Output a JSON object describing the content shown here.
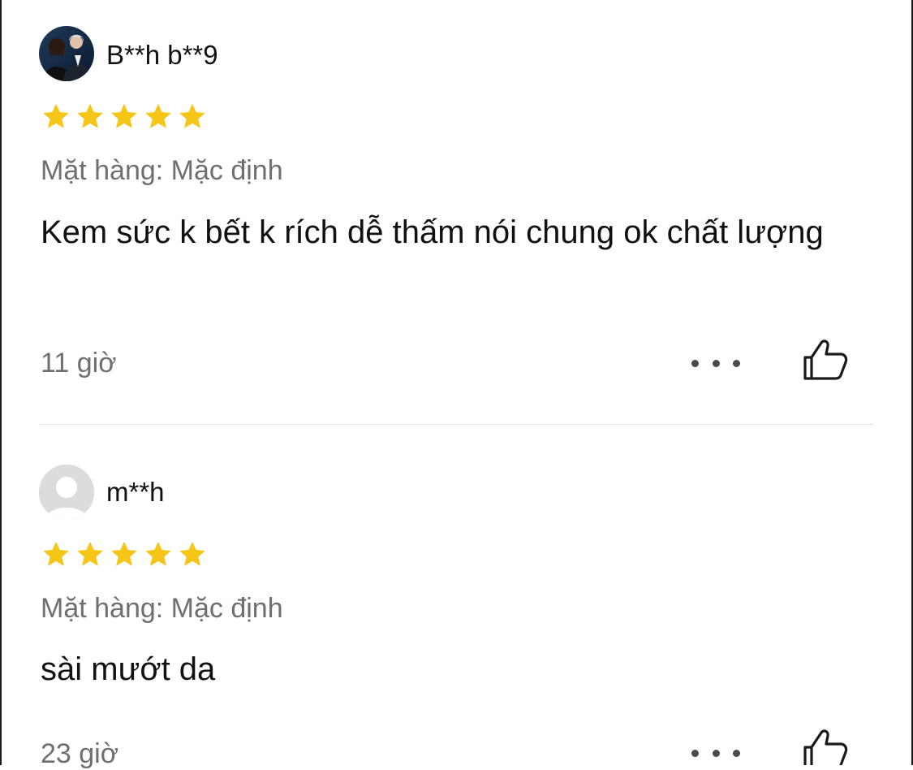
{
  "reviews": [
    {
      "username": "B**h b**9",
      "rating": 5,
      "variant": "Mặt hàng: Mặc định",
      "comment": "Kem sức k bết k rích dễ thấm nói chung ok chất lượng",
      "time": "11 giờ",
      "avatar_type": "photo"
    },
    {
      "username": "m**h",
      "rating": 5,
      "variant": "Mặt hàng: Mặc định",
      "comment": "sài mướt da",
      "time": "23 giờ",
      "avatar_type": "default-placeholder"
    }
  ],
  "icons": {
    "star": "star-icon",
    "more": "more-dots-icon",
    "like": "thumbs-up-icon"
  },
  "colors": {
    "star": "#F5C518",
    "secondary_text": "#6f6f6f",
    "primary_text": "#111111",
    "divider": "#e4e4e4"
  }
}
